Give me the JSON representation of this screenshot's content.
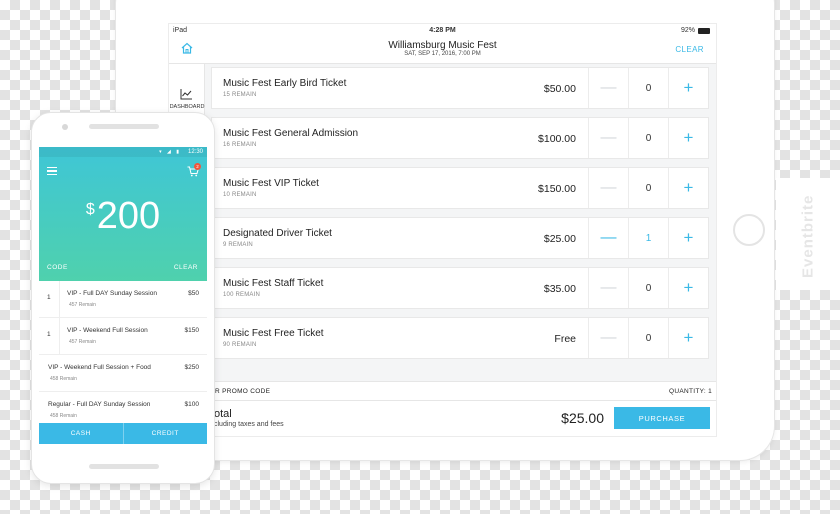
{
  "tablet": {
    "status": {
      "device": "iPad",
      "time": "4:28 PM",
      "battery": "92%"
    },
    "nav": {
      "title": "Williamsburg Music Fest",
      "subtitle": "SAT, SEP 17, 2016, 7:00 PM",
      "clear_label": "CLEAR"
    },
    "sidebar": {
      "dashboard_label": "DASHBOARD"
    },
    "tickets": [
      {
        "name": "Music Fest Early Bird Ticket",
        "remain": "15 REMAIN",
        "price": "$50.00",
        "qty": "0"
      },
      {
        "name": "Music Fest General Admission",
        "remain": "16 REMAIN",
        "price": "$100.00",
        "qty": "0"
      },
      {
        "name": "Music Fest VIP Ticket",
        "remain": "10 REMAIN",
        "price": "$150.00",
        "qty": "0"
      },
      {
        "name": "Designated Driver Ticket",
        "remain": "9 REMAIN",
        "price": "$25.00",
        "qty": "1"
      },
      {
        "name": "Music Fest Staff Ticket",
        "remain": "100 REMAIN",
        "price": "$35.00",
        "qty": "0"
      },
      {
        "name": "Music Fest Free Ticket",
        "remain": "90 REMAIN",
        "price": "Free",
        "qty": "0"
      }
    ],
    "stepper": {
      "minus": "—",
      "plus": "+"
    },
    "promo": {
      "label": "R PROMO CODE",
      "quantity": "QUANTITY: 1"
    },
    "total": {
      "title": "otal",
      "subtitle": "cluding taxes and fees",
      "amount": "$25.00",
      "purchase_label": "PURCHASE"
    },
    "side_tab_text": "Eventbrite"
  },
  "phone": {
    "status": {
      "time": "12:30",
      "icons": "▾ ◢ ▮"
    },
    "cart_badge": "2",
    "amount": {
      "currency": "$",
      "value": "200"
    },
    "code_label": "CODE",
    "clear_label": "CLEAR",
    "items": [
      {
        "qty": "1",
        "name": "VIP - Full DAY Sunday Session",
        "remain": "457 Remain",
        "price": "$50"
      },
      {
        "qty": "1",
        "name": "VIP - Weekend Full Session",
        "remain": "457 Remain",
        "price": "$150"
      },
      {
        "qty": "",
        "name": "VIP - Weekend Full Session + Food",
        "remain": "458 Remain",
        "price": "$250"
      },
      {
        "qty": "",
        "name": "Regular - Full DAY Sunday Session",
        "remain": "458 Remain",
        "price": "$100"
      }
    ],
    "cash_label": "CASH",
    "credit_label": "CREDIT"
  },
  "colors": {
    "accent": "#3ab9e6",
    "gradient_top": "#3fc6d6",
    "gradient_bottom": "#4fd1ad",
    "badge": "#f0563c"
  },
  "icons": {
    "home": "home-icon",
    "dashboard": "line-chart-icon",
    "menu": "hamburger-menu-icon",
    "cart": "shopping-cart-icon"
  }
}
